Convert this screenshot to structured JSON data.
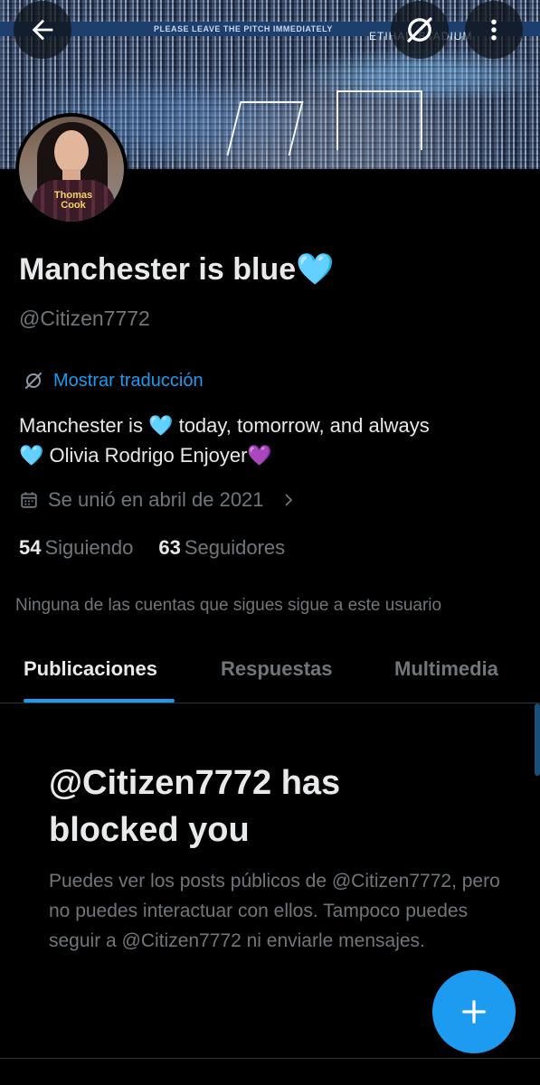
{
  "banner": {
    "strip_text": "PLEASE LEAVE THE PITCH IMMEDIATELY",
    "stadium_text": "ETIHAD STADIUM"
  },
  "avatar": {
    "shirt_text": "Thomas Cook"
  },
  "profile": {
    "display_name": "Manchester is blue",
    "name_emoji": "🩵",
    "handle": "@Citizen7772",
    "translate_label": "Mostrar traducción",
    "bio_line1_a": "Manchester is ",
    "bio_heart": "🩵",
    "bio_line1_b": " today, tomorrow, and always",
    "bio_heart2": "🩵",
    "bio_line2": " Olivia Rodrigo Enjoyer",
    "bio_purple_heart": "💜",
    "joined": "Se unió en abril de 2021",
    "following_count": "54",
    "following_label": "Siguiendo",
    "followers_count": "63",
    "followers_label": "Seguidores",
    "mutual_note": "Ninguna de las cuentas que sigues sigue a este usuario"
  },
  "tabs": [
    {
      "label": "Publicaciones",
      "active": true
    },
    {
      "label": "Respuestas",
      "active": false
    },
    {
      "label": "Multimedia",
      "active": false
    }
  ],
  "blocked": {
    "title": "@Citizen7772 has blocked you",
    "description": "Puedes ver los posts públicos de @Citizen7772, pero no puedes interactuar con ellos. Tampoco puedes seguir a @Citizen7772 ni enviarle mensajes."
  },
  "colors": {
    "accent": "#1d9bf0",
    "background": "#000000",
    "primary_text": "#e7e9ea",
    "secondary_text": "#71767b"
  },
  "icons": {
    "back": "arrow-left-icon",
    "translate": "translate-icon",
    "more": "more-vertical-icon",
    "calendar": "calendar-icon",
    "chevron": "chevron-right-icon",
    "compose": "plus-icon"
  }
}
